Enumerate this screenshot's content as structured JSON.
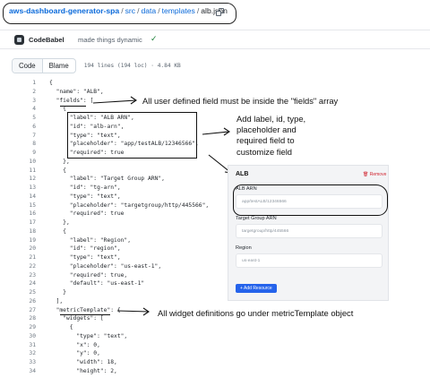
{
  "breadcrumb": {
    "repo": "aws-dashboard-generator-spa",
    "path": [
      "src",
      "data",
      "templates"
    ],
    "file": "alb.json"
  },
  "commit": {
    "author": "CodeBabel",
    "message": "made things dynamic",
    "status": "✓"
  },
  "toolbar": {
    "code_tab": "Code",
    "blame_tab": "Blame",
    "file_meta": "194 lines (194 loc) · 4.84 KB"
  },
  "code_lines": [
    "{",
    "  \"name\": \"ALB\",",
    "  \"fields\": [",
    "    {",
    "      \"label\": \"ALB ARN\",",
    "      \"id\": \"alb-arn\",",
    "      \"type\": \"text\",",
    "      \"placeholder\": \"app/testALB/12346566\",",
    "      \"required\": true",
    "    },",
    "    {",
    "      \"label\": \"Target Group ARN\",",
    "      \"id\": \"tg-arn\",",
    "      \"type\": \"text\",",
    "      \"placeholder\": \"targetgroup/http/445566\",",
    "      \"required\": true",
    "    },",
    "    {",
    "      \"label\": \"Region\",",
    "      \"id\": \"region\",",
    "      \"type\": \"text\",",
    "      \"placeholder\": \"us-east-1\",",
    "      \"required\": true,",
    "      \"default\": \"us-east-1\"",
    "    }",
    "  ],",
    "  \"metricTemplate\": {",
    "    \"widgets\": [",
    "      {",
    "        \"type\": \"text\",",
    "        \"x\": 0,",
    "        \"y\": 0,",
    "        \"width\": 18,",
    "        \"height\": 2,"
  ],
  "annotations": {
    "fields_note": "All user defined field must be inside the \"fields\" array",
    "customize_note": "Add label, id, type,\nplaceholder and\nrequired field to\ncustomize field",
    "metric_note": "All widget definitions go under metricTemplate object"
  },
  "preview": {
    "title": "ALB",
    "remove_label": "Remove",
    "fields": [
      {
        "label": "ALB ARN",
        "placeholder": "app/testALB/12346566"
      },
      {
        "label": "Target Group ARN",
        "placeholder": "targetgroup/http/445566"
      },
      {
        "label": "Region",
        "placeholder": "us-east-1"
      }
    ],
    "add_button": "+ Add Resource"
  },
  "colors": {
    "link": "#0969da",
    "success": "#1a7f37",
    "danger": "#d1242f",
    "button": "#2563eb"
  }
}
